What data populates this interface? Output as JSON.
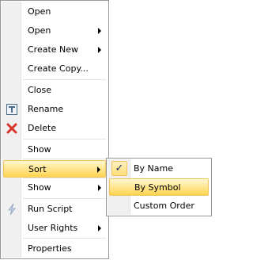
{
  "menu": {
    "items": [
      {
        "label": "Open"
      },
      {
        "label": "Open",
        "submenu": true
      },
      {
        "label": "Create New",
        "submenu": true
      },
      {
        "label": "Create Copy..."
      },
      {
        "label": "Close"
      },
      {
        "label": "Rename",
        "icon": "rename-icon"
      },
      {
        "label": "Delete",
        "icon": "delete-icon"
      },
      {
        "label": "Show"
      },
      {
        "label": "Sort",
        "submenu": true,
        "highlighted": true
      },
      {
        "label": "Show",
        "submenu": true
      },
      {
        "label": "Run Script",
        "icon": "lightning-icon"
      },
      {
        "label": "User Rights",
        "submenu": true
      },
      {
        "label": "Properties"
      }
    ]
  },
  "submenu": {
    "items": [
      {
        "label": "By Name",
        "checked": true
      },
      {
        "label": "By Symbol",
        "highlighted": true
      },
      {
        "label": "Custom Order"
      }
    ],
    "check_glyph": "✓"
  },
  "colors": {
    "highlight": "#ffe48a",
    "delete_icon": "#d9342b",
    "rename_icon": "#4a6b8a"
  }
}
